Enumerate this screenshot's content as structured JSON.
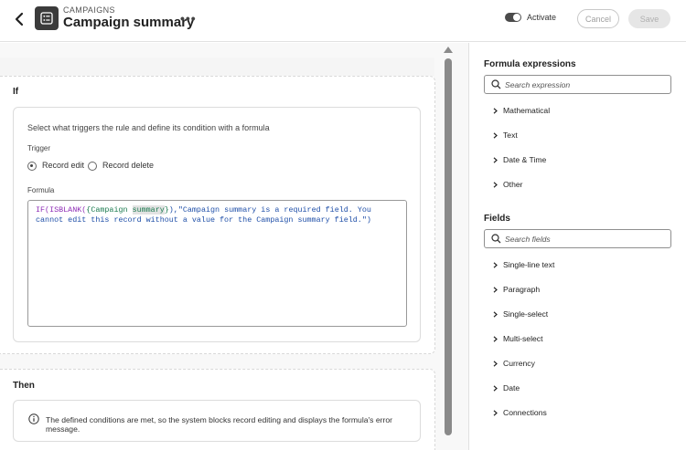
{
  "header": {
    "breadcrumb": "CAMPAIGNS",
    "title": "Campaign summary",
    "more_label": "•••",
    "activate_label": "Activate",
    "cancel_label": "Cancel",
    "save_label": "Save"
  },
  "if_section": {
    "title": "If",
    "description": "Select what triggers the rule and define its condition with a formula",
    "trigger_label": "Trigger",
    "trigger_options": [
      "Record edit",
      "Record delete"
    ],
    "selected_trigger": "Record edit",
    "formula_label": "Formula",
    "formula": {
      "fn": "IF(ISBLANK(",
      "field_open": "{Campaign ",
      "field_hl": "summary",
      "field_close": "}",
      "rest": "),\"Campaign summary is a required field. You cannot edit this record without a value for the Campaign summary field.\")"
    }
  },
  "then_section": {
    "title": "Then",
    "message": "The defined conditions are met, so the system blocks record editing and displays the formula's error message."
  },
  "sidebar": {
    "formula_title": "Formula expressions",
    "expression_search_placeholder": "Search expression",
    "expression_categories": [
      "Mathematical",
      "Text",
      "Date & Time",
      "Other"
    ],
    "fields_title": "Fields",
    "fields_search_placeholder": "Search fields",
    "field_types": [
      "Single-line text",
      "Paragraph",
      "Single-select",
      "Multi-select",
      "Currency",
      "Date",
      "Connections"
    ]
  },
  "colors": {
    "formula_string": "#1f4fa8",
    "formula_function": "#8e2db5",
    "formula_field": "#1b7a4f"
  }
}
